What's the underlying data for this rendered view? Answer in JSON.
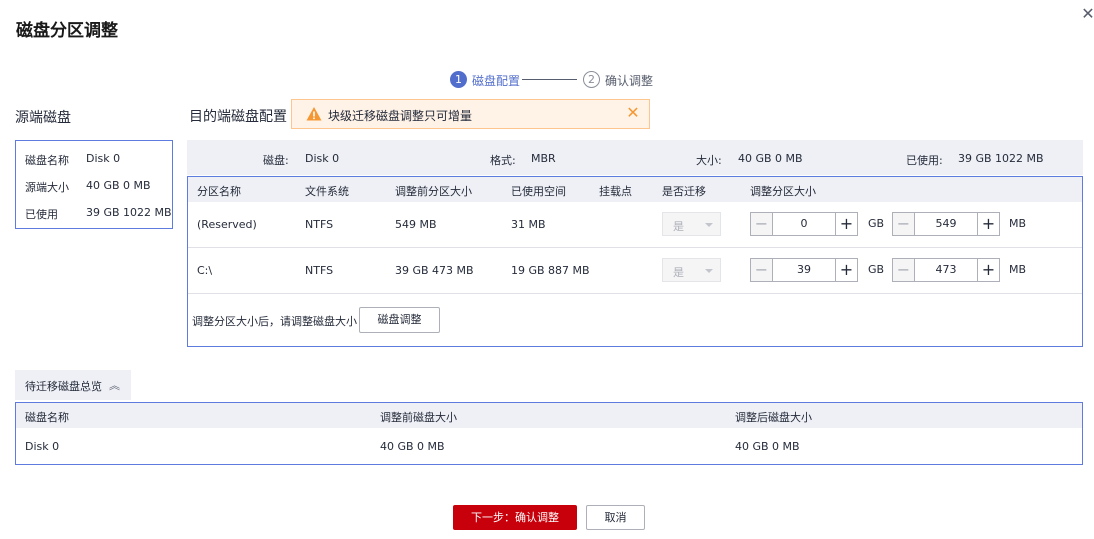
{
  "dialog": {
    "title": "磁盘分区调整",
    "close_icon": "close-icon"
  },
  "steps": [
    {
      "number": "1",
      "label": "磁盘配置",
      "active": true
    },
    {
      "number": "2",
      "label": "确认调整",
      "active": false
    }
  ],
  "source": {
    "heading": "源端磁盘",
    "rows": [
      {
        "key": "磁盘名称",
        "value": "Disk 0"
      },
      {
        "key": "源端大小",
        "value": "40 GB 0 MB"
      },
      {
        "key": "已使用",
        "value": "39 GB 1022 MB"
      }
    ]
  },
  "target": {
    "heading": "目的端磁盘配置",
    "alert": {
      "icon": "warning-icon",
      "text": "块级迁移磁盘调整只可增量"
    },
    "info": {
      "disk_label": "磁盘:",
      "disk_value": "Disk 0",
      "format_label": "格式:",
      "format_value": "MBR",
      "size_label": "大小:",
      "size_value": "40 GB 0 MB",
      "used_label": "已使用:",
      "used_value": "39 GB 1022 MB"
    },
    "columns": [
      "分区名称",
      "文件系统",
      "调整前分区大小",
      "已使用空间",
      "挂载点",
      "是否迁移",
      "调整分区大小"
    ],
    "rows": [
      {
        "name": "(Reserved)",
        "fs": "NTFS",
        "before": "549 MB",
        "used": "31 MB",
        "mount": "",
        "migrate": "是",
        "gb": "0",
        "gb_unit": "GB",
        "mb": "549",
        "mb_unit": "MB"
      },
      {
        "name": "C:\\",
        "fs": "NTFS",
        "before": "39 GB 473 MB",
        "used": "19 GB 887 MB",
        "mount": "",
        "migrate": "是",
        "gb": "39",
        "gb_unit": "GB",
        "mb": "473",
        "mb_unit": "MB"
      }
    ],
    "hint": "调整分区大小后，请调整磁盘大小",
    "adjust_button": "磁盘调整"
  },
  "overview": {
    "tab_label": "待迁移磁盘总览",
    "columns": [
      "磁盘名称",
      "调整前磁盘大小",
      "调整后磁盘大小"
    ],
    "rows": [
      {
        "name": "Disk 0",
        "before": "40 GB 0 MB",
        "after": "40 GB 0 MB"
      }
    ]
  },
  "footer": {
    "next_label": "下一步：确认调整",
    "cancel_label": "取消"
  },
  "colors": {
    "primary": "#526ecc",
    "danger": "#c7000b",
    "warning": "#f59833",
    "border": "#5e7ce0"
  }
}
